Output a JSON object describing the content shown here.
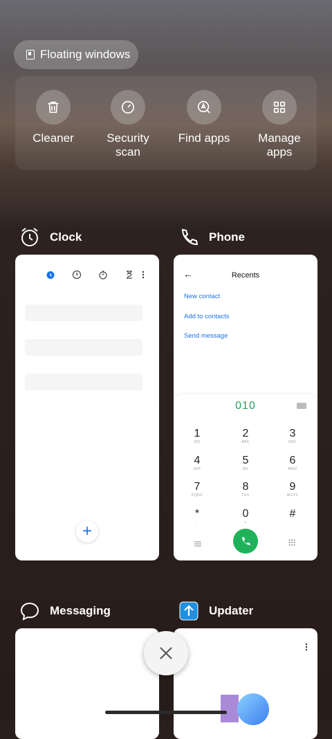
{
  "floating_windows": {
    "label": "Floating windows",
    "icon": "floating-window-icon"
  },
  "tools": [
    {
      "label": "Cleaner",
      "icon": "trash-icon"
    },
    {
      "label": "Security\nscan",
      "icon": "security-scan-icon"
    },
    {
      "label": "Find apps",
      "icon": "find-apps-icon"
    },
    {
      "label": "Manage\napps",
      "icon": "grid-icon"
    }
  ],
  "apps": {
    "clock": {
      "title": "Clock",
      "icon": "alarm-clock-icon",
      "fab": "+"
    },
    "phone": {
      "title": "Phone",
      "icon": "phone-icon",
      "recents_title": "Recents",
      "links": [
        "New contact",
        "Add to contacts",
        "Send message"
      ],
      "dialed_number": "010",
      "keys": [
        {
          "d": "1",
          "l": "GD"
        },
        {
          "d": "2",
          "l": "ABC"
        },
        {
          "d": "3",
          "l": "DEF"
        },
        {
          "d": "4",
          "l": "GHI"
        },
        {
          "d": "5",
          "l": "JKL"
        },
        {
          "d": "6",
          "l": "MNO"
        },
        {
          "d": "7",
          "l": "PQRS"
        },
        {
          "d": "8",
          "l": "TUV"
        },
        {
          "d": "9",
          "l": "WXYZ"
        },
        {
          "d": "*",
          "l": ","
        },
        {
          "d": "0",
          "l": "+"
        },
        {
          "d": "#",
          "l": ""
        }
      ]
    },
    "messaging": {
      "title": "Messaging",
      "icon": "message-bubble-icon"
    },
    "updater": {
      "title": "Updater",
      "icon": "update-arrow-icon"
    }
  },
  "colors": {
    "accent": "#1a73e8",
    "call_green": "#1fb25a",
    "dial_number": "#2aa05a"
  }
}
